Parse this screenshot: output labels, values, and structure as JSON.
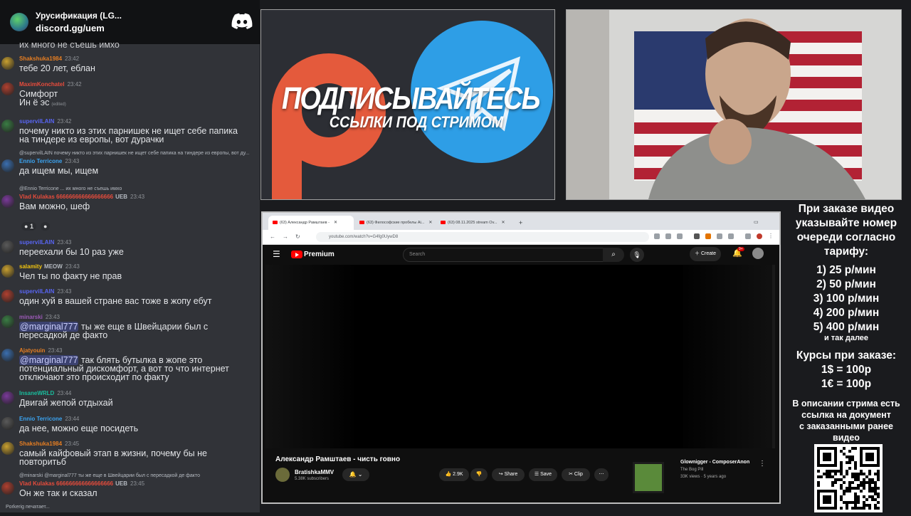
{
  "discord": {
    "server_name": "Урусификация (LG...",
    "server_link": "discord.gg/uem"
  },
  "chat": {
    "top_cut": "их много не съешь имхо",
    "messages": [
      {
        "name": "Shakshuka1984",
        "time": "23:42",
        "lines": [
          "тебе 20 лет, еблан"
        ],
        "name_color": "#e67e22"
      },
      {
        "name": "MaximKonchatel",
        "time": "23:42",
        "lines": [
          "Симфорт",
          "Ин ё эс"
        ],
        "name_color": "#e74c3c",
        "edited": "(edited)"
      },
      {
        "name": "supervilLAIN",
        "time": "23:42",
        "lines": [
          "почему никто из этих парнишек не ищет себе папика",
          "на тиндере из европы, вот дурачки"
        ],
        "name_color": "#5865f2"
      },
      {
        "reply": "@supervilLAIN почему никто из этих парнишек не ищет себе папика на тиндере из европы, вот ду...",
        "name": "Ennio Terricone",
        "time": "23:43",
        "lines": [
          "да ищем мы, ищем"
        ],
        "name_color": "#3ba3f0"
      },
      {
        "reply": "@Ennio Terricone ... их много не съешь имхо",
        "name": "Vlad Kulakas 666666666666666666",
        "tag": "UEB",
        "time": "23:43",
        "lines": [
          "Вам можно, шеф"
        ],
        "name_color": "#e74c3c",
        "reactions": [
          "1",
          ""
        ]
      },
      {
        "name": "supervilLAIN",
        "time": "23:43",
        "lines": [
          "переехали бы 10 раз уже"
        ],
        "name_color": "#5865f2"
      },
      {
        "name": "salamity",
        "tag": "MEOW",
        "time": "23:43",
        "lines": [
          "Чел ты по факту не прав"
        ],
        "name_color": "#f1c40f"
      },
      {
        "name": "supervilLAIN",
        "time": "23:43",
        "lines": [
          "один хуй в вашей стране вас тоже в жопу ебут"
        ],
        "name_color": "#5865f2"
      },
      {
        "name": "minarski",
        "time": "23:43",
        "mention": "@marginal777",
        "lines": [
          "ты же еще в Швейцарии был с",
          "пересадкой де факто"
        ],
        "name_color": "#9b59b6"
      },
      {
        "name": "Ajatyouin",
        "time": "23:43",
        "mention": "@marginal777",
        "lines": [
          "так блять бутылка в жопе это",
          "потенциальный дискомфорт, а вот то что интернет",
          "отключают это происходит по факту"
        ],
        "name_color": "#e67e22"
      },
      {
        "name": "InsaneWRLD",
        "time": "23:44",
        "lines": [
          "Двигай жепой отдыхай"
        ],
        "name_color": "#1abc9c"
      },
      {
        "name": "Ennio Terricone",
        "time": "23:44",
        "lines": [
          "да нее, можно еще посидеть"
        ],
        "name_color": "#3ba3f0"
      },
      {
        "name": "Shakshuka1984",
        "time": "23:45",
        "lines": [
          "самый кайфовый этап в жизни, почему бы не",
          "повторитьб"
        ],
        "name_color": "#e67e22"
      },
      {
        "reply": "@minarski @marginal777 ты же еще в Швейцарии был с пересадкой де факто",
        "name": "Vlad Kulakas 666666666666666666",
        "tag": "UEB",
        "time": "23:45",
        "lines": [
          "Он же так и сказал"
        ],
        "name_color": "#e74c3c"
      }
    ],
    "typing": "Porkerig печатает..."
  },
  "banner": {
    "title": "ПОДПИСЫВАЙТЕСЬ",
    "subtitle": "ССЫЛКИ ПОД СТРИМОМ"
  },
  "browser": {
    "tabs": [
      "(63) Александр Рамштаев -",
      "(63) Философские пробелы Ai...",
      "(63) 08.11.2025 stream Ov..."
    ],
    "url": "youtube.com/watch?v=G4fg0UywD8",
    "brand": "Premium",
    "search_placeholder": "Search",
    "create_label": "Create",
    "notif_badge": "9+",
    "video_title": "Александр Рамштаев - чисть говно",
    "channel_name": "BratishkaMMV",
    "channel_subs": "5.38K subscribers",
    "likes": "2.9K",
    "share_label": "Share",
    "save_label": "Save",
    "clip_label": "Clip",
    "rec_title": "Glownigger - ComposerAnon",
    "rec_channel": "The Bog Pill",
    "rec_meta": "33K views · 5 years ago",
    "rec_duration": "2:55"
  },
  "info": {
    "intro": [
      "При заказе видео",
      "указывайте номер",
      "очереди согласно",
      "тарифу:"
    ],
    "tariffs": [
      "1) 25 р/мин",
      "2) 50 р/мин",
      "3) 100 р/мин",
      "4) 200 р/мин",
      "5) 400 р/мин"
    ],
    "etc": "и так далее",
    "rates_title": "Курсы при заказе:",
    "rates": [
      "1$ = 100р",
      "1€ = 100р"
    ],
    "desc": [
      "В описании стрима есть",
      "ссылка на документ",
      "с заказанными ранее",
      "видео"
    ]
  }
}
